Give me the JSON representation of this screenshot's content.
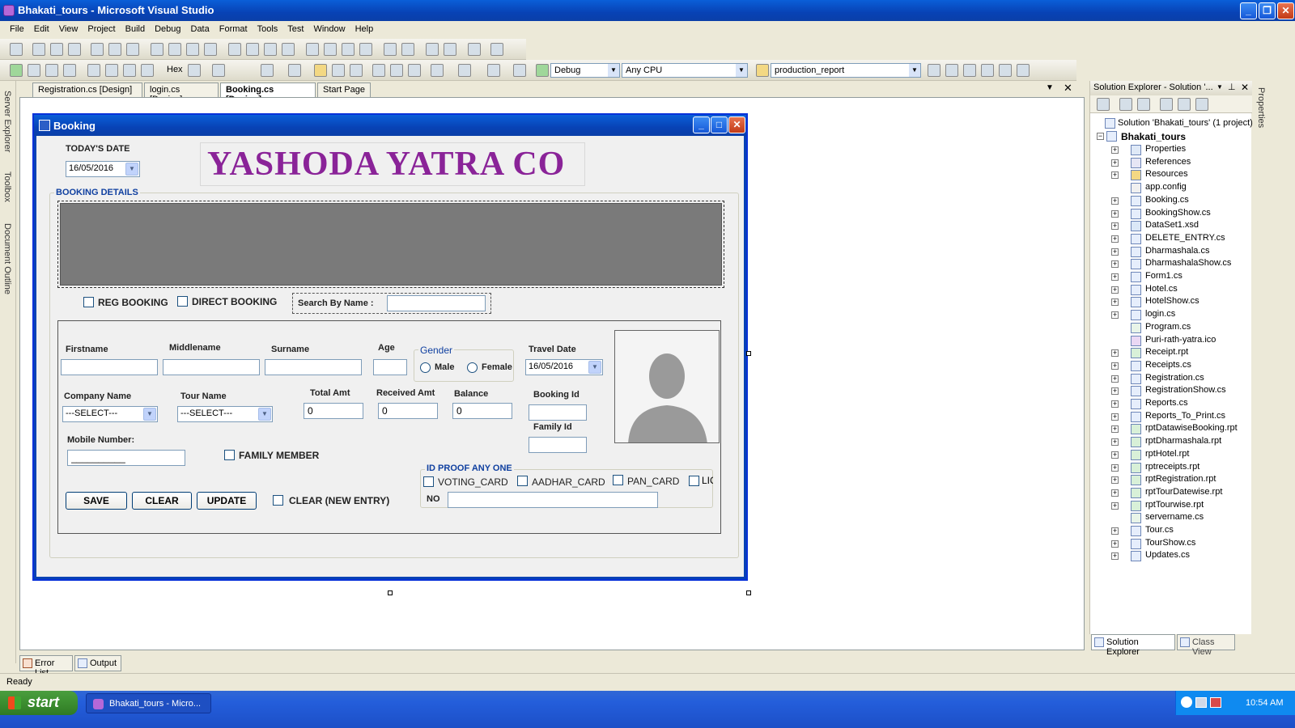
{
  "window": {
    "title": "Bhakati_tours - Microsoft Visual Studio"
  },
  "menu": [
    "File",
    "Edit",
    "View",
    "Project",
    "Build",
    "Debug",
    "Data",
    "Format",
    "Tools",
    "Test",
    "Window",
    "Help"
  ],
  "toolbar": {
    "hex_label": "Hex",
    "config": "Debug",
    "platform": "Any CPU",
    "startup_project": "production_report"
  },
  "left_strip": {
    "server_explorer": "Server Explorer",
    "toolbox": "Toolbox",
    "document_outline": "Document Outline"
  },
  "doc_tabs": [
    {
      "label": "Registration.cs [Design]",
      "active": false
    },
    {
      "label": "login.cs [Design]",
      "active": false
    },
    {
      "label": "Booking.cs [Design]",
      "active": true
    },
    {
      "label": "Start Page",
      "active": false
    }
  ],
  "form": {
    "title": "Booking",
    "todays_date_label": "TODAY'S DATE",
    "todays_date_value": "16/05/2016",
    "company_banner": "YASHODA YATRA CO",
    "booking_details_label": "BOOKING DETAILS",
    "reg_booking_label": "REG BOOKING",
    "direct_booking_label": "DIRECT BOOKING",
    "search_by_name_label": "Search By Name :",
    "search_by_name_value": "",
    "firstname_label": "Firstname",
    "middlename_label": "Middlename",
    "surname_label": "Surname",
    "age_label": "Age",
    "gender_label": "Gender",
    "male_label": "Male",
    "female_label": "Female",
    "travel_date_label": "Travel Date",
    "travel_date_value": "16/05/2016",
    "company_name_label": "Company Name",
    "company_name_value": "---SELECT---",
    "tour_name_label": "Tour Name",
    "tour_name_value": "---SELECT---",
    "total_amt_label": "Total Amt",
    "total_amt_value": "0",
    "received_amt_label": "Received Amt",
    "received_amt_value": "0",
    "balance_label": "Balance",
    "balance_value": "0",
    "booking_id_label": "Booking Id",
    "family_id_label": "Family Id",
    "mobile_number_label": "Mobile Number:",
    "mobile_number_value": "__________",
    "family_member_label": "FAMILY MEMBER",
    "id_proof_label": "ID PROOF ANY ONE",
    "voting_card_label": "VOTING_CARD",
    "aadhar_card_label": "AADHAR_CARD",
    "pan_card_label": "PAN_CARD",
    "lic_label": "LIC",
    "no_label": "NO",
    "save_label": "SAVE",
    "clear_label": "CLEAR",
    "update_label": "UPDATE",
    "clear_new_entry_label": "CLEAR (NEW ENTRY)"
  },
  "solution_explorer": {
    "title": "Solution Explorer - Solution '...",
    "solution_label": "Solution 'Bhakati_tours' (1 project)",
    "project_label": "Bhakati_tours",
    "items": [
      {
        "label": "Properties",
        "icon": "properties-icon",
        "expandable": true
      },
      {
        "label": "References",
        "icon": "references-icon",
        "expandable": true
      },
      {
        "label": "Resources",
        "icon": "folder-icon",
        "expandable": true
      },
      {
        "label": "app.config",
        "icon": "config-file-icon",
        "expandable": false
      },
      {
        "label": "Booking.cs",
        "icon": "form-icon",
        "expandable": true
      },
      {
        "label": "BookingShow.cs",
        "icon": "form-icon",
        "expandable": true
      },
      {
        "label": "DataSet1.xsd",
        "icon": "dataset-icon",
        "expandable": true
      },
      {
        "label": "DELETE_ENTRY.cs",
        "icon": "form-icon",
        "expandable": true
      },
      {
        "label": "Dharmashala.cs",
        "icon": "form-icon",
        "expandable": true
      },
      {
        "label": "DharmashalaShow.cs",
        "icon": "form-icon",
        "expandable": true
      },
      {
        "label": "Form1.cs",
        "icon": "form-icon",
        "expandable": true
      },
      {
        "label": "Hotel.cs",
        "icon": "form-icon",
        "expandable": true
      },
      {
        "label": "HotelShow.cs",
        "icon": "form-icon",
        "expandable": true
      },
      {
        "label": "login.cs",
        "icon": "form-icon",
        "expandable": true
      },
      {
        "label": "Program.cs",
        "icon": "code-file-icon",
        "expandable": false
      },
      {
        "label": "Puri-rath-yatra.ico",
        "icon": "icon-file-icon",
        "expandable": false
      },
      {
        "label": "Receipt.rpt",
        "icon": "report-icon",
        "expandable": true
      },
      {
        "label": "Receipts.cs",
        "icon": "form-icon",
        "expandable": true
      },
      {
        "label": "Registration.cs",
        "icon": "form-icon",
        "expandable": true
      },
      {
        "label": "RegistrationShow.cs",
        "icon": "form-icon",
        "expandable": true
      },
      {
        "label": "Reports.cs",
        "icon": "form-icon",
        "expandable": true
      },
      {
        "label": "Reports_To_Print.cs",
        "icon": "form-icon",
        "expandable": true
      },
      {
        "label": "rptDatawiseBooking.rpt",
        "icon": "report-icon",
        "expandable": true
      },
      {
        "label": "rptDharmashala.rpt",
        "icon": "report-icon",
        "expandable": true
      },
      {
        "label": "rptHotel.rpt",
        "icon": "report-icon",
        "expandable": true
      },
      {
        "label": "rptreceipts.rpt",
        "icon": "report-icon",
        "expandable": true
      },
      {
        "label": "rptRegistration.rpt",
        "icon": "report-icon",
        "expandable": true
      },
      {
        "label": "rptTourDatewise.rpt",
        "icon": "report-icon",
        "expandable": true
      },
      {
        "label": "rptTourwise.rpt",
        "icon": "report-icon",
        "expandable": true
      },
      {
        "label": "servername.cs",
        "icon": "code-file-icon",
        "expandable": false
      },
      {
        "label": "Tour.cs",
        "icon": "form-icon",
        "expandable": true
      },
      {
        "label": "TourShow.cs",
        "icon": "form-icon",
        "expandable": true
      },
      {
        "label": "Updates.cs",
        "icon": "form-icon",
        "expandable": true
      }
    ],
    "tab_solution_explorer": "Solution Explorer",
    "tab_class_view": "Class View"
  },
  "right_strip": {
    "properties": "Properties"
  },
  "bottom_tabs": {
    "error_list": "Error List",
    "output": "Output"
  },
  "status": {
    "text": "Ready"
  },
  "taskbar": {
    "start_label": "start",
    "task_label": "Bhakati_tours - Micro...",
    "clock": "10:54 AM"
  }
}
